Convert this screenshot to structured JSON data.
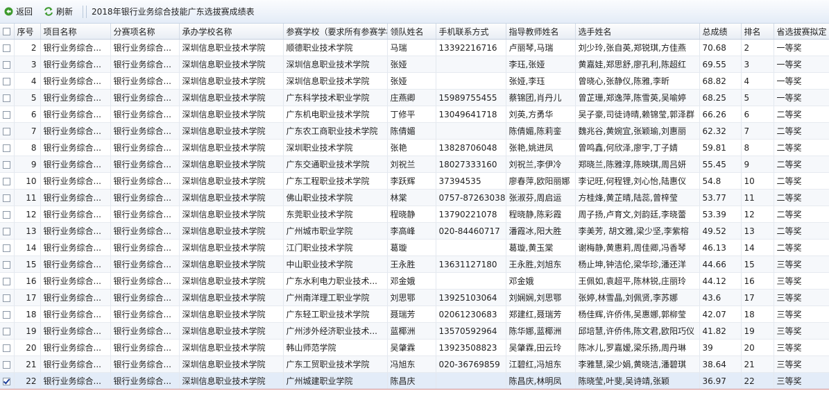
{
  "toolbar": {
    "back_label": "返回",
    "refresh_label": "刷新",
    "title": "2018年银行业务综合技能广东选拔赛成绩表"
  },
  "colors": {
    "toolbar_bg": "#e4ecf7",
    "selected_row": "#e3ecf8",
    "back_icon": "#3e9a2e",
    "refresh_icon": "#3e9a2e"
  },
  "table": {
    "headers": [
      "序号",
      "项目名称",
      "分赛项名称",
      "承办学校名称",
      "参赛学校（要求所有参赛学校",
      "领队姓名",
      "手机联系方式",
      "指导教师姓名",
      "选手姓名",
      "总成绩",
      "排名",
      "省选拔赛拟定"
    ],
    "rows": [
      {
        "checked": false,
        "cells": [
          "2",
          "银行业务综合...",
          "银行业务综合...",
          "深圳信息职业技术学院",
          "顺德职业技术学院",
          "马瑞",
          "13392216716",
          "卢丽琴,马瑞",
          "刘少玲,张自英,郑锐琪,方佳燕",
          "70.68",
          "2",
          "一等奖"
        ]
      },
      {
        "checked": false,
        "cells": [
          "3",
          "银行业务综合...",
          "银行业务综合...",
          "深圳信息职业技术学院",
          "深圳信息职业技术学院",
          "张娅",
          "",
          "李珏,张娅",
          "黄嘉娃,郑思舒,廖孔利,陈超红",
          "69.55",
          "3",
          "一等奖"
        ]
      },
      {
        "checked": false,
        "cells": [
          "4",
          "银行业务综合...",
          "银行业务综合...",
          "深圳信息职业技术学院",
          "深圳信息职业技术学院",
          "张娅",
          "",
          "张娅,李珏",
          "曾晓心,张静仪,陈雅,李昕",
          "68.82",
          "4",
          "一等奖"
        ]
      },
      {
        "checked": false,
        "cells": [
          "5",
          "银行业务综合...",
          "银行业务综合...",
          "深圳信息职业技术学院",
          "广东科学技术职业学院",
          "庄燕卿",
          "15989755455",
          "蔡锦团,肖丹儿",
          "曾芷珊,郑逸萍,陈雪英,吴喻婷",
          "68.25",
          "5",
          "一等奖"
        ]
      },
      {
        "checked": false,
        "cells": [
          "6",
          "银行业务综合...",
          "银行业务综合...",
          "深圳信息职业技术学院",
          "广东机电职业技术学院",
          "丁修平",
          "13049641718",
          "刘英,方勇华",
          "吴子豪,司徒诗晴,赖锦莹,郭泽群",
          "66.26",
          "6",
          "二等奖"
        ]
      },
      {
        "checked": false,
        "cells": [
          "7",
          "银行业务综合...",
          "银行业务综合...",
          "深圳信息职业技术学院",
          "广东农工商职业技术学院",
          "陈倩媚",
          "",
          "陈倩媚,陈莉銮",
          "魏兆谷,黄婉宜,张颖瑜,刘惠丽",
          "62.32",
          "7",
          "二等奖"
        ]
      },
      {
        "checked": false,
        "cells": [
          "8",
          "银行业务综合...",
          "银行业务综合...",
          "深圳信息职业技术学院",
          "深圳职业技术学院",
          "张艳",
          "13828706048",
          "张艳,姚进凤",
          "曾鸣鑫,何欣泽,廖宇,丁子婧",
          "59.81",
          "8",
          "二等奖"
        ]
      },
      {
        "checked": false,
        "cells": [
          "9",
          "银行业务综合...",
          "银行业务综合...",
          "深圳信息职业技术学院",
          "广东交通职业技术学院",
          "刘祝兰",
          "18027333160",
          "刘祝兰,李伊冷",
          "郑晓兰,陈雅淳,陈映琪,周吕妍",
          "55.45",
          "9",
          "二等奖"
        ]
      },
      {
        "checked": false,
        "cells": [
          "10",
          "银行业务综合...",
          "银行业务综合...",
          "深圳信息职业技术学院",
          "广东工程职业技术学院",
          "李跃辉",
          "37394535",
          "廖春萍,欧阳丽娜",
          "李记旺,何程锂,刘心怡,陆惠仪",
          "54.8",
          "10",
          "二等奖"
        ]
      },
      {
        "checked": false,
        "cells": [
          "11",
          "银行业务综合...",
          "银行业务综合...",
          "深圳信息职业技术学院",
          "佛山职业技术学院",
          "林棠",
          "0757-87263038",
          "张淑芬,周启运",
          "方桂烽,黄芷晴,陆蕊,曾梓莹",
          "53.77",
          "11",
          "二等奖"
        ]
      },
      {
        "checked": false,
        "cells": [
          "12",
          "银行业务综合...",
          "银行业务综合...",
          "深圳信息职业技术学院",
          "东莞职业技术学院",
          "程晓静",
          "13790221078",
          "程晓静,陈彩霞",
          "周子扬,卢育文,刘韵廷,李晓蕾",
          "53.39",
          "12",
          "二等奖"
        ]
      },
      {
        "checked": false,
        "cells": [
          "13",
          "银行业务综合...",
          "银行业务综合...",
          "深圳信息职业技术学院",
          "广州城市职业学院",
          "李高峰",
          "020-84460717",
          "潘霞冰,阳大胜",
          "李美芳, 胡文雅,梁少坚,李紫榕",
          "49.52",
          "13",
          "二等奖"
        ]
      },
      {
        "checked": false,
        "cells": [
          "14",
          "银行业务综合...",
          "银行业务综合...",
          "深圳信息职业技术学院",
          "江门职业技术学院",
          "葛璇",
          "",
          "葛璇,黄玉棠",
          "谢梅静,黄惠莉,周佳卿,冯香琴",
          "46.13",
          "14",
          "二等奖"
        ]
      },
      {
        "checked": false,
        "cells": [
          "15",
          "银行业务综合...",
          "银行业务综合...",
          "深圳信息职业技术学院",
          "中山职业技术学院",
          "王永胜",
          "13631127180",
          "王永胜,刘旭东",
          "杨止坤,钟洁伦,梁华珍,潘还洋",
          "44.66",
          "15",
          "三等奖"
        ]
      },
      {
        "checked": false,
        "cells": [
          "16",
          "银行业务综合...",
          "银行业务综合...",
          "深圳信息职业技术学院",
          "广东水利电力职业技术...",
          "邓金娥",
          "",
          "邓金娥",
          "王佩如,袁超平,陈林锐,庄丽玲",
          "44.12",
          "16",
          "三等奖"
        ]
      },
      {
        "checked": false,
        "cells": [
          "17",
          "银行业务综合...",
          "银行业务综合...",
          "深圳信息职业技术学院",
          "广州南洋理工职业学院",
          "刘思鄂",
          "13925103064",
          "刘娴娴,刘思鄂",
          "张婷,林雪晶,刘佩贤,李苏娜",
          "43.6",
          "17",
          "三等奖"
        ]
      },
      {
        "checked": false,
        "cells": [
          "18",
          "银行业务综合...",
          "银行业务综合...",
          "深圳信息职业技术学院",
          "广东轻工职业技术学院",
          "聂瑞芳",
          "02061230683",
          "郑建红,聂瑞芳",
          "杨佳辉,许侨伟,吴惠娜,郭柳莹",
          "42.07",
          "18",
          "三等奖"
        ]
      },
      {
        "checked": false,
        "cells": [
          "19",
          "银行业务综合...",
          "银行业务综合...",
          "深圳信息职业技术学院",
          "广州涉外经济职业技术...",
          "蓝椰洲",
          "13570592964",
          "陈华娜,蓝椰洲",
          "邱培慧,许侨伟,陈文君,欧阳巧仪",
          "41.82",
          "19",
          "三等奖"
        ]
      },
      {
        "checked": false,
        "cells": [
          "20",
          "银行业务综合...",
          "银行业务综合...",
          "深圳信息职业技术学院",
          "韩山师范学院",
          "吴肇霖",
          "13923508823",
          "吴肇霖,田云玲",
          "陈冰儿,罗嘉嫒,梁乐扬,周丹琳",
          "39",
          "20",
          "三等奖"
        ]
      },
      {
        "checked": false,
        "cells": [
          "21",
          "银行业务综合...",
          "银行业务综合...",
          "深圳信息职业技术学院",
          "广东工贸职业技术学院",
          "冯旭东",
          "020-36769859",
          "江碧红,冯旭东",
          "李雅慧,梁少娟,黄晓洁,潘碧琪",
          "38.64",
          "21",
          "三等奖"
        ]
      },
      {
        "checked": true,
        "cells": [
          "22",
          "银行业务综合...",
          "银行业务综合...",
          "深圳信息职业技术学院",
          "广州城建职业学院",
          "陈昌庆",
          "",
          "陈昌庆,林明凤",
          "陈晓莹,叶斐,吴诗靖,张颖",
          "36.97",
          "22",
          "三等奖"
        ]
      }
    ]
  }
}
